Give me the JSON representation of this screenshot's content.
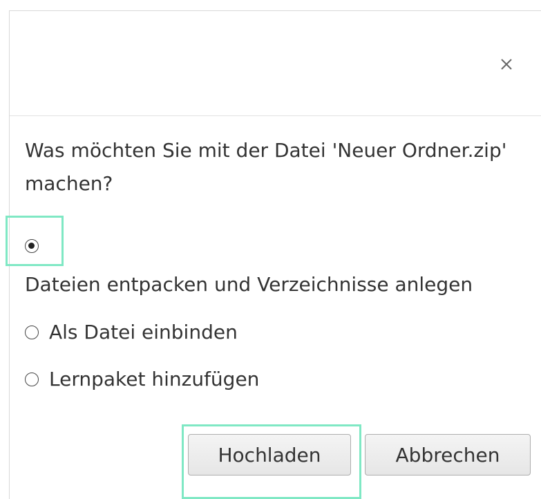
{
  "dialog": {
    "close_label": "×",
    "question": "Was möchten Sie mit der Datei 'Neuer Ordner.zip' machen?",
    "options": [
      {
        "label": "Dateien entpacken und Verzeichnisse anlegen",
        "selected": true
      },
      {
        "label": "Als Datei einbinden",
        "selected": false
      },
      {
        "label": "Lernpaket hinzufügen",
        "selected": false
      }
    ],
    "buttons": {
      "upload_label": "Hochladen",
      "cancel_label": "Abbrechen"
    }
  },
  "colors": {
    "highlight": "#7fe8c4",
    "border": "#d8d8d8",
    "text": "#333333"
  }
}
